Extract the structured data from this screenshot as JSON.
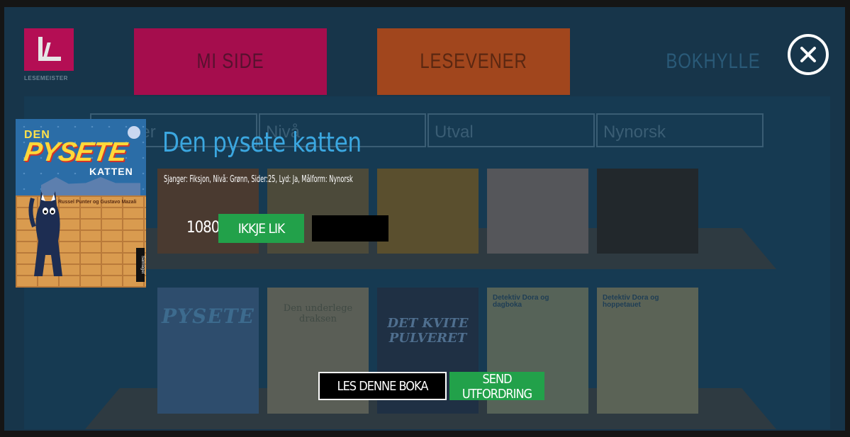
{
  "app": {
    "logo_text": "LESEMEISTER",
    "tabs": [
      {
        "label": "MI SIDE",
        "color": "#a50d4d"
      },
      {
        "label": "LESEVENER",
        "color": "#a1461d"
      },
      {
        "label": "BOKHYLLE",
        "color": "#17354a"
      }
    ],
    "filters": [
      {
        "label": "Sjanger"
      },
      {
        "label": "Nivå"
      },
      {
        "label": "Utval"
      },
      {
        "label": "Nynorsk"
      }
    ],
    "shelf_books_row2": [
      {
        "title": "Den underlege draksen"
      },
      {
        "title": "DET KVITE PULVERET"
      },
      {
        "title": "Detektiv Dora og dagboka"
      },
      {
        "title": "Detektiv Dora og hoppetauet"
      }
    ]
  },
  "modal": {
    "close_icon": "close-circle-icon",
    "cover": {
      "line1": "DEN",
      "line2": "PYSETE",
      "line3": "KATTEN",
      "authors": "Russel Punter og Gustavo Mazali",
      "publisher": "Samlaget"
    },
    "title": "Den pysete katten",
    "meta": "Sjanger: Fiksjon, Nivå: Grønn, Sider:25, Lyd: Ja, Målform: Nynorsk",
    "like_count": "1080",
    "like_button": "IKKJE LIK",
    "read_button": "LES DENNE BOKA",
    "send_button": "SEND UTFORDRING",
    "accent_green": "#22a14a",
    "title_color": "#3ba7e0"
  }
}
